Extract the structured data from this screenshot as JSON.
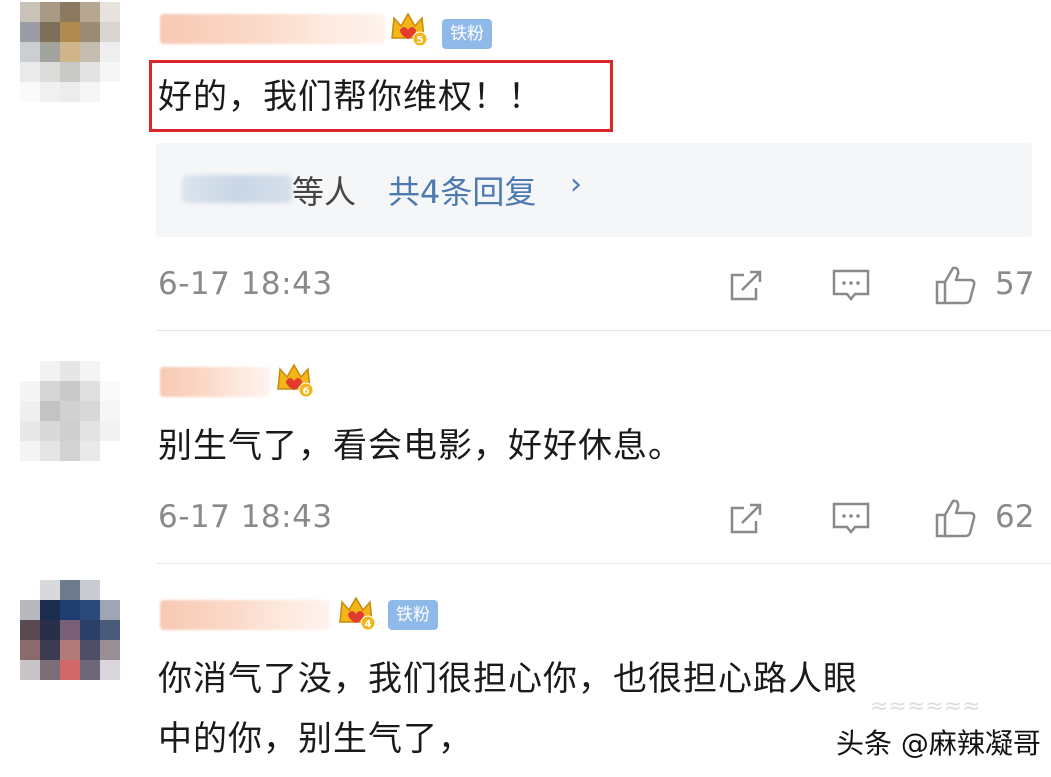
{
  "comments": [
    {
      "badge_level": "5",
      "fan_badge": "铁粉",
      "text": "好的，我们帮你维权！！",
      "highlighted": true,
      "replies": {
        "suffix": "等人",
        "count_label": "共4条回复",
        "chevron": "›"
      },
      "time": "6-17 18:43",
      "likes": "57"
    },
    {
      "badge_level": "6",
      "text": "别生气了，看会电影，好好休息。",
      "time": "6-17 18:43",
      "likes": "62"
    },
    {
      "badge_level": "4",
      "fan_badge": "铁粉",
      "text_line1": "你消气了没，我们很担心你，也很担心路人眼",
      "text_line2": "中的你，别生气了，"
    }
  ],
  "watermark": "头条 @麻辣凝哥",
  "colors": {
    "highlight_border": "#e0242b",
    "reply_link": "#4d7ab0",
    "fan_badge_bg": "#8fb9e8",
    "crown_gold": "#f2b51a",
    "meta_gray": "#8a8a8a"
  },
  "icons": [
    "share-icon",
    "comment-icon",
    "like-icon",
    "crown-badge-icon"
  ]
}
